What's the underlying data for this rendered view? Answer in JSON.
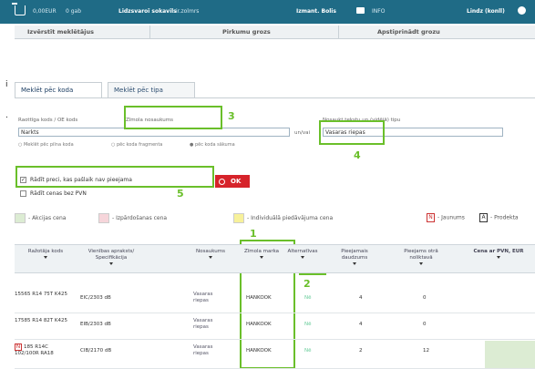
{
  "topbar": {
    "cart_amount": "0,00EUR",
    "cart_count": "0 gab",
    "account_link": "Lidzsvaroī sokavils",
    "account_sub": "ir.zolmrs",
    "user_info": "Izmant. Bolis",
    "messages_label": "INFO",
    "user_menu": "Lindz (konll)"
  },
  "subnav": {
    "items": [
      "Izvērstīt meklētājus",
      "Pirkumu grozs",
      "Apstiprinādt grozu"
    ]
  },
  "side_chars": [
    "i",
    "."
  ],
  "tabs": [
    "Meklēt pēc koda",
    "Meklēt pēc tipa"
  ],
  "search": {
    "code_label": "Raottīga kods / OE kods",
    "code_value": "Narkts",
    "brand_value": "Zīmola nosaukums",
    "and_or": "un/vai",
    "desc_label": "Nosaukt tekstu un (vidējā) tipu",
    "desc_value": "Vasaras riepas",
    "radio_options": [
      "Meklēt pēc pilna koda",
      "pēc koda fragmenta",
      "pēc koda sākuma"
    ],
    "only_in_stock": "Rādīt preci, kas pašlaik nav pieejama",
    "no_pvn": "Rādīt cenas bez PVN",
    "ok_label": "OK"
  },
  "annotations": [
    "3",
    "4",
    "5",
    "1",
    "2"
  ],
  "legend": {
    "items": [
      "- Akcijas cena",
      "- Izpārdošanas cena",
      "- Individuālā piedāvājuma cena",
      "- Jaunums",
      "- Prodekta"
    ],
    "colors": [
      "#dcecd3",
      "#f6d5da",
      "#f7f19a"
    ],
    "icons": [
      "N",
      "A"
    ]
  },
  "table": {
    "headers": [
      "Ražotāja kods",
      "Vienības apraksts/ Specifikācija",
      "Nosaukums",
      "Zīmola marka",
      "Alternatīvas",
      "Pieejamais daudzums",
      "Pieejams otrā noliktavā",
      "Cena ar PVN, EUR"
    ],
    "rows": [
      {
        "code": "15565 R14 75T K425",
        "spec": "EIC/2303 dB",
        "name": "Vasaras riepas",
        "brand": "HANKOOK",
        "alt": "Nē",
        "qty": "4",
        "qty2": "0",
        "new": false
      },
      {
        "code": "17585 R14 82T K425",
        "spec": "EIB/2303 dB",
        "name": "Vasaras riepas",
        "brand": "HANKOOK",
        "alt": "Nē",
        "qty": "4",
        "qty2": "0",
        "new": false
      },
      {
        "code": "185 R14C 102/100R RA18",
        "spec": "CIB/2170 dB",
        "name": "Vasaras riepas",
        "brand": "HANKOOK",
        "alt": "Nē",
        "qty": "2",
        "qty2": "12",
        "new": true,
        "new_label": "N"
      }
    ]
  }
}
